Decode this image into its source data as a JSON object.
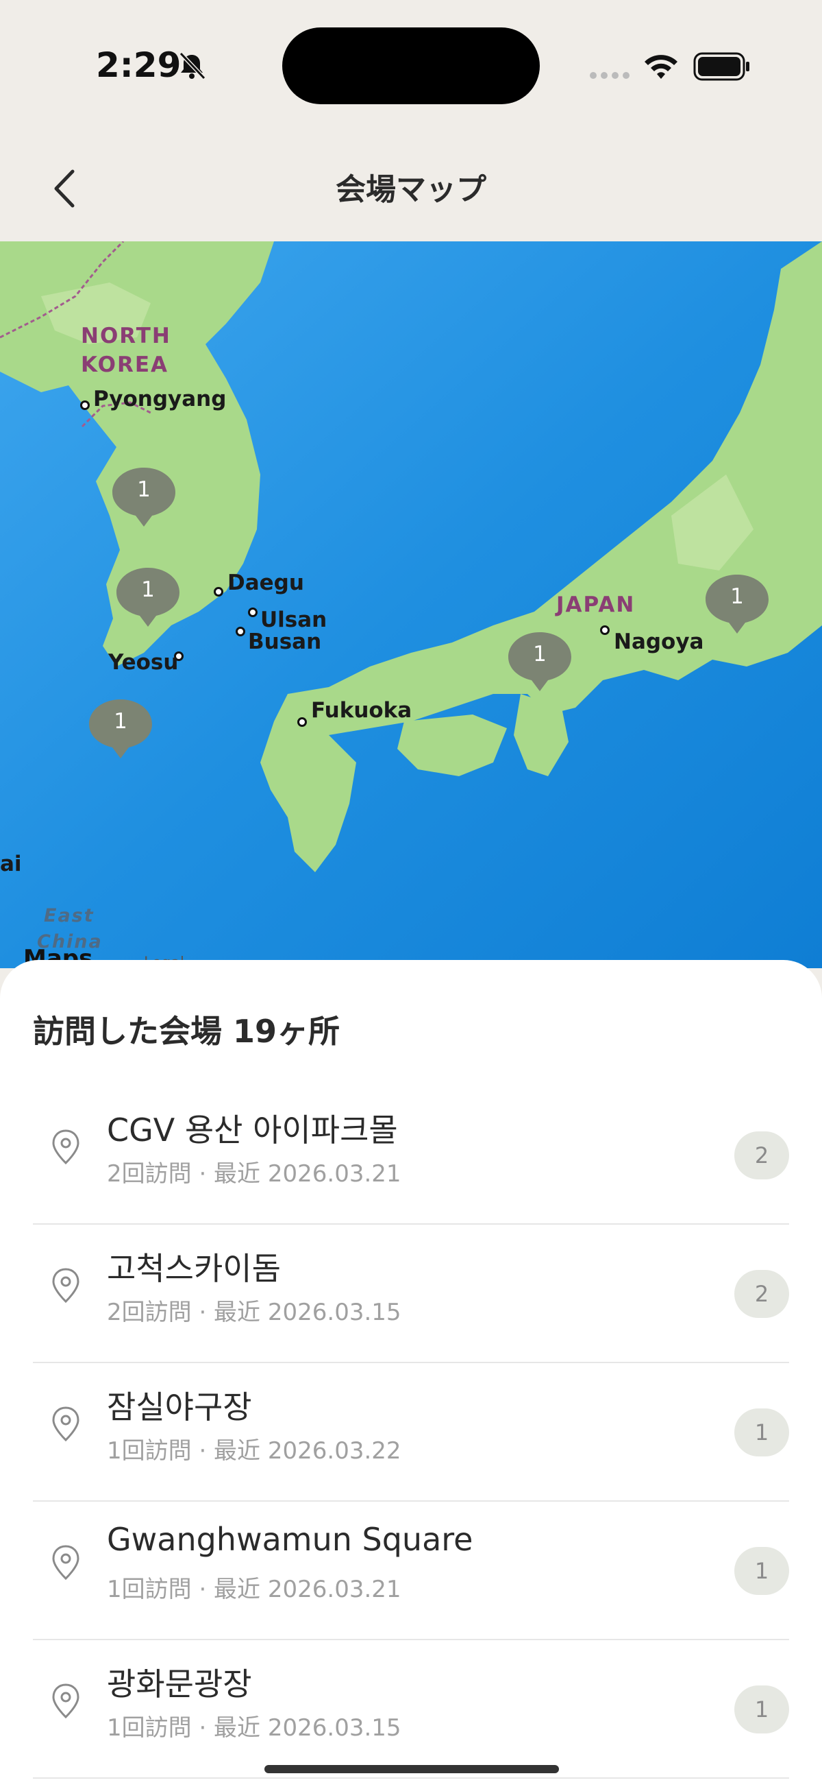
{
  "status_bar": {
    "time": "2:29"
  },
  "nav": {
    "title": "会場マップ"
  },
  "map": {
    "country_labels": [
      {
        "id": "north-korea-line1",
        "text": "NORTH"
      },
      {
        "id": "north-korea-line2",
        "text": "KOREA"
      },
      {
        "id": "japan",
        "text": "JAPAN"
      }
    ],
    "cities": [
      {
        "id": "pyongyang",
        "text": "Pyongyang"
      },
      {
        "id": "daegu",
        "text": "Daegu"
      },
      {
        "id": "ulsan",
        "text": "Ulsan"
      },
      {
        "id": "busan",
        "text": "Busan"
      },
      {
        "id": "yeosu",
        "text": "Yeosu"
      },
      {
        "id": "fukuoka",
        "text": "Fukuoka"
      },
      {
        "id": "nagoya",
        "text": "Nagoya"
      }
    ],
    "markers": [
      {
        "id": "seoul",
        "count": "1"
      },
      {
        "id": "daejeon",
        "count": "1"
      },
      {
        "id": "jeju",
        "count": "1"
      },
      {
        "id": "osaka",
        "count": "1"
      },
      {
        "id": "tokyo",
        "count": "1"
      }
    ],
    "sea_label_line1": "East",
    "sea_label_line2": "China",
    "edge_label": "ai",
    "logo_text": "Maps",
    "legal_text": "Legal"
  },
  "sheet": {
    "title": "訪問した会場 19ヶ所",
    "venues": [
      {
        "name": "CGV 용산 아이파크몰",
        "meta": "2回訪問 · 最近 2026.03.21",
        "count": "2"
      },
      {
        "name": "고척스카이돔",
        "meta": "2回訪問 · 最近 2026.03.15",
        "count": "2"
      },
      {
        "name": "잠실야구장",
        "meta": "1回訪問 · 最近 2026.03.22",
        "count": "1"
      },
      {
        "name": "Gwanghwamun Square",
        "meta": "1回訪問 · 最近 2026.03.21",
        "count": "1"
      },
      {
        "name": "광화문광장",
        "meta": "1回訪問 · 最近 2026.03.15",
        "count": "1"
      }
    ]
  },
  "colors": {
    "background": "#f0ede8",
    "sea": "#2d9be6",
    "land": "#a9d98a",
    "marker": "#7c8473",
    "country_label": "#8a3e74"
  }
}
